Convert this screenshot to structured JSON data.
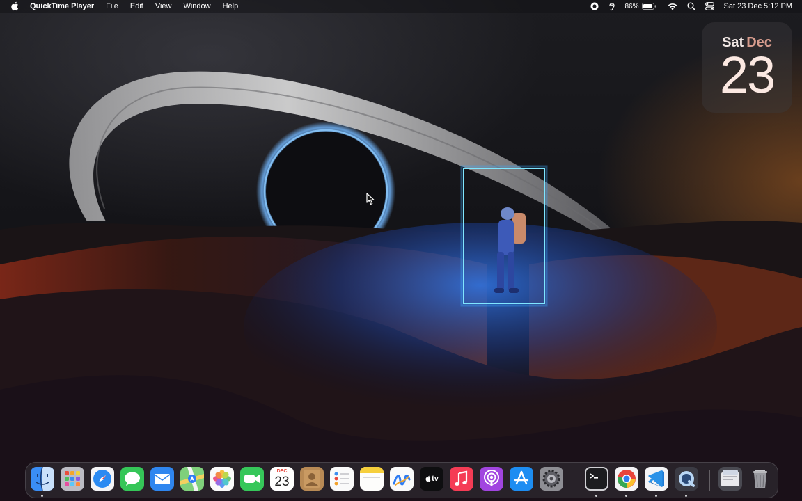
{
  "menubar": {
    "app_name": "QuickTime Player",
    "menus": [
      "File",
      "Edit",
      "View",
      "Window",
      "Help"
    ],
    "battery_percent": "86%",
    "clock": "Sat 23 Dec  5:12 PM",
    "status_icons": [
      "screen-recording-icon",
      "hearing-icon",
      "battery-icon",
      "wifi-icon",
      "spotlight-search-icon",
      "control-center-icon"
    ]
  },
  "widget": {
    "day": "Sat",
    "month": "Dec",
    "date": "23"
  },
  "dock": {
    "calendar_month": "DEC",
    "calendar_date": "23",
    "tv_label": "tv",
    "apps": [
      "Finder",
      "Launchpad",
      "Safari",
      "Messages",
      "Mail",
      "Maps",
      "Photos",
      "FaceTime",
      "Calendar",
      "Contacts",
      "Reminders",
      "Notes",
      "Freeform",
      "TV",
      "Music",
      "Podcasts",
      "App Store",
      "System Settings",
      "Terminal",
      "Google Chrome",
      "Visual Studio Code",
      "QuickTime Player",
      "Documents",
      "Trash"
    ],
    "running": [
      "Finder",
      "Terminal",
      "Google Chrome",
      "Visual Studio Code",
      "QuickTime Player"
    ]
  },
  "colors": {
    "portal": "#7fe6ff",
    "widget_date": "#fbe8e1",
    "widget_month": "#d79c8d"
  }
}
